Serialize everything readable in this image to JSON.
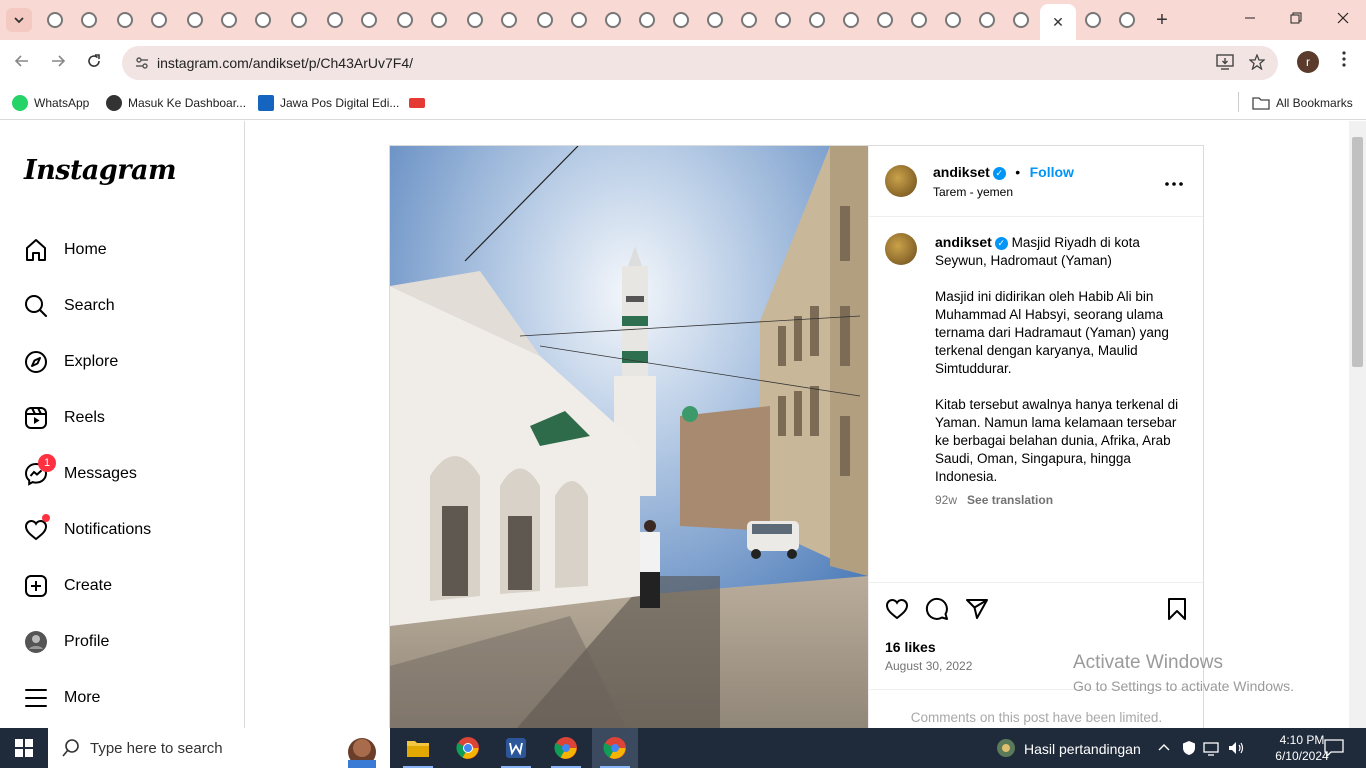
{
  "browser": {
    "active_tab_close": "✕",
    "new_tab": "+",
    "url": "instagram.com/andikset/p/Ch43ArUv7F4/",
    "profile_initial": "r",
    "bookmarks": [
      {
        "label": "WhatsApp",
        "color": "#25d366"
      },
      {
        "label": "Masuk Ke Dashboar...",
        "color": "#333333"
      },
      {
        "label": "Jawa Pos Digital Edi...",
        "color": "#1565c0"
      },
      {
        "label": "",
        "color": "#e53935"
      }
    ],
    "all_bookmarks": "All Bookmarks"
  },
  "instagram": {
    "logo": "Instagram",
    "nav": [
      {
        "label": "Home",
        "icon": "home-icon"
      },
      {
        "label": "Search",
        "icon": "search-icon"
      },
      {
        "label": "Explore",
        "icon": "compass-icon"
      },
      {
        "label": "Reels",
        "icon": "reels-icon"
      },
      {
        "label": "Messages",
        "icon": "messenger-icon",
        "badge": "1"
      },
      {
        "label": "Notifications",
        "icon": "heart-icon"
      },
      {
        "label": "Create",
        "icon": "plus-square-icon"
      },
      {
        "label": "Profile",
        "icon": "profile-avatar-icon"
      },
      {
        "label": "More",
        "icon": "hamburger-icon"
      }
    ]
  },
  "post": {
    "username": "andikset",
    "follow": "Follow",
    "bullet": "•",
    "location": "Tarem - yemen",
    "caption_head": "Masjid Riyadh di kota Seywun,  Hadromaut (Yaman)",
    "caption_p1": "Masjid ini didirikan oleh Habib Ali bin Muhammad Al Habsyi, seorang ulama ternama dari Hadramaut (Yaman) yang terkenal dengan karyanya, Maulid Simtuddurar.",
    "caption_p2": "Kitab tersebut awalnya hanya terkenal di Yaman. Namun lama kelamaan tersebar ke berbagai belahan dunia, Afrika, Arab Saudi, Oman, Singapura, hingga Indonesia.",
    "age": "92w",
    "see_translation": "See translation",
    "likes": "16 likes",
    "date": "August 30, 2022",
    "comments_limited": "Comments on this post have been limited."
  },
  "watermark": {
    "line1": "Activate Windows",
    "line2": "Go to Settings to activate Windows."
  },
  "taskbar": {
    "search_placeholder": "Type here to search",
    "news": "Hasil pertandingan",
    "time": "4:10 PM",
    "date": "6/10/2024"
  }
}
